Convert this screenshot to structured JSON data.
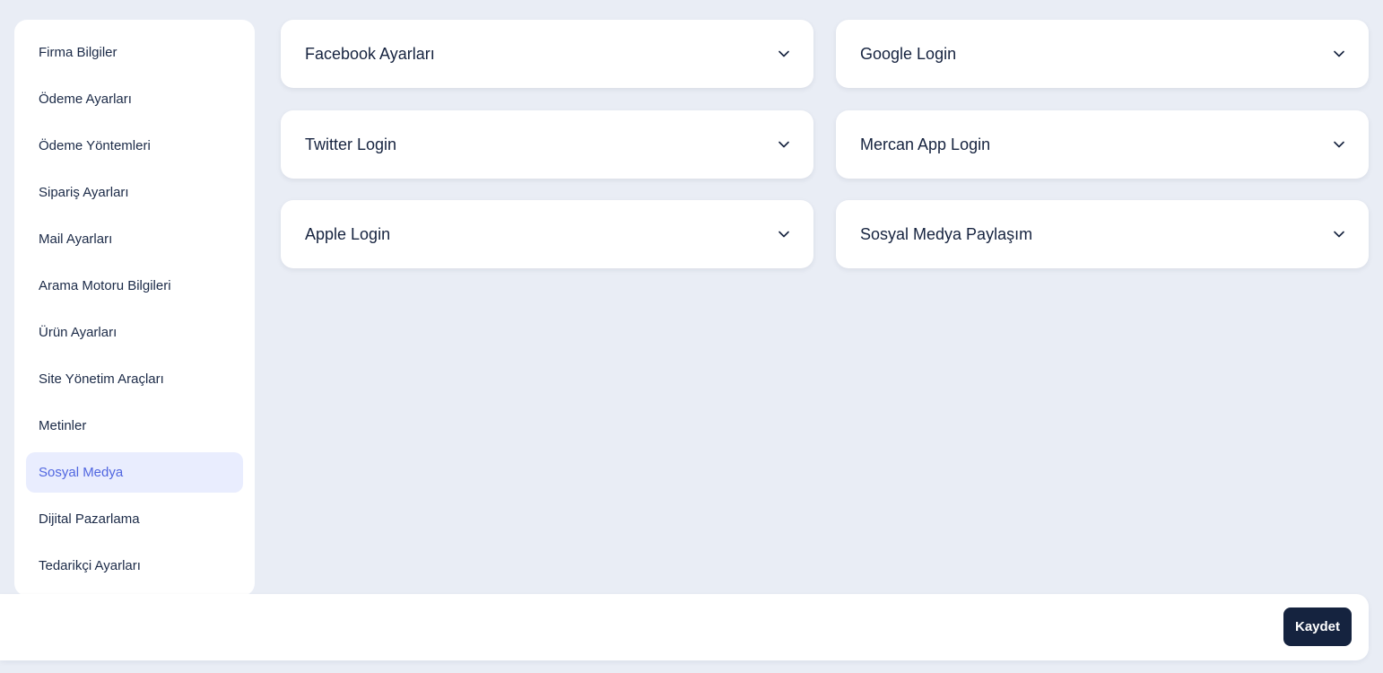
{
  "sidebar": {
    "items": [
      {
        "label": "Firma Bilgiler"
      },
      {
        "label": "Ödeme Ayarları"
      },
      {
        "label": "Ödeme Yöntemleri"
      },
      {
        "label": "Sipariş Ayarları"
      },
      {
        "label": "Mail Ayarları"
      },
      {
        "label": "Arama Motoru Bilgileri"
      },
      {
        "label": "Ürün Ayarları"
      },
      {
        "label": "Site Yönetim Araçları"
      },
      {
        "label": "Metinler"
      },
      {
        "label": "Sosyal Medya",
        "active": true
      },
      {
        "label": "Dijital Pazarlama"
      },
      {
        "label": "Tedarikçi Ayarları"
      }
    ]
  },
  "panels": [
    {
      "title": "Facebook Ayarları"
    },
    {
      "title": "Google Login"
    },
    {
      "title": "Twitter Login"
    },
    {
      "title": "Mercan App Login"
    },
    {
      "title": "Apple Login"
    },
    {
      "title": "Sosyal Medya Paylaşım"
    }
  ],
  "footer": {
    "save_label": "Kaydet"
  },
  "icons": {
    "panel_toggle": "chevron-down-icon"
  },
  "colors": {
    "background": "#e9edf5",
    "active_bg": "#e9edfe",
    "active_text": "#5066e0",
    "primary_button": "#15233f"
  }
}
